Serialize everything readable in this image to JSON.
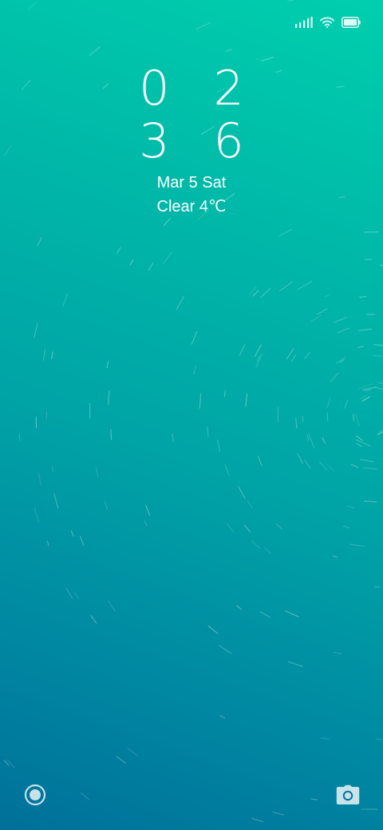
{
  "status_bar": {
    "icons": [
      "cellular-signal-icon",
      "wifi-icon",
      "battery-icon"
    ]
  },
  "clock": {
    "hours": "0 2",
    "minutes": "3 6"
  },
  "date": "Mar 5 Sat",
  "weather": "Clear 4℃",
  "shortcuts": {
    "left": "target-icon",
    "right": "camera-icon"
  },
  "colors": {
    "gradient_top": "#00cfae",
    "gradient_bottom": "#00709a",
    "foreground": "#ffffff"
  }
}
